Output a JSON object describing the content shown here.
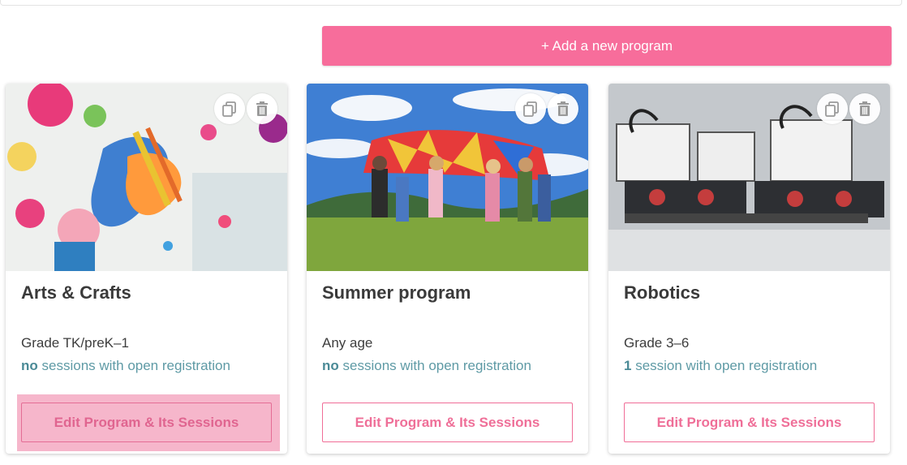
{
  "header": {
    "add_label": "+ Add a new program"
  },
  "cards": [
    {
      "title": "Arts & Crafts",
      "grade": "Grade TK/preK–1",
      "sessions_count": "no",
      "sessions_text": " sessions with open registration",
      "edit_label": "Edit Program & Its Sessions",
      "image": "arts-crafts-photo"
    },
    {
      "title": "Summer program",
      "grade": "Any age",
      "sessions_count": "no",
      "sessions_text": " sessions with open registration",
      "edit_label": "Edit Program & Its Sessions",
      "image": "summer-parachute-photo"
    },
    {
      "title": "Robotics",
      "grade": "Grade 3–6",
      "sessions_count": "1",
      "sessions_text": " session with open registration",
      "edit_label": "Edit Program & Its Sessions",
      "image": "lego-robots-photo"
    }
  ],
  "icons": {
    "copy": "copy-icon",
    "delete": "trash-icon"
  },
  "colors": {
    "accent": "#f76d9b",
    "link_teal": "#5e9aa5",
    "highlight": "#f6b6cb"
  }
}
